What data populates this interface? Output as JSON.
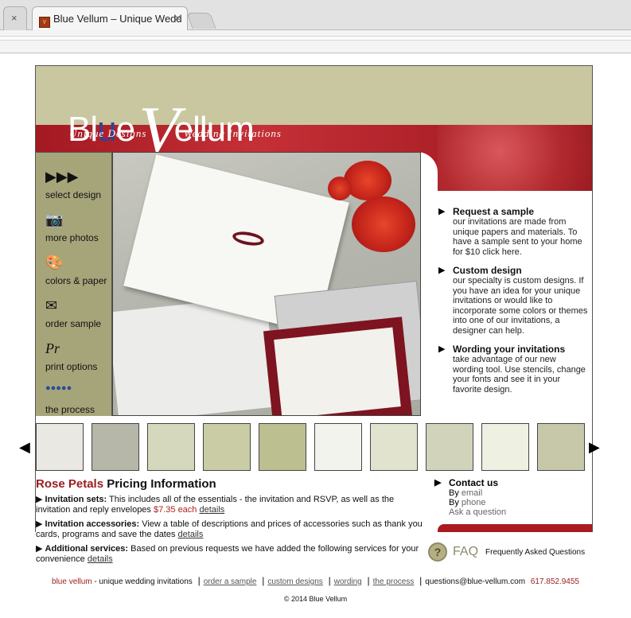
{
  "browser": {
    "active_tab_title": "Blue Vellum – Unique Wedd",
    "close_glyph": "×"
  },
  "site": {
    "logo_blue": "Blue",
    "logo_v": "V",
    "logo_rest": "ellum",
    "tagline_left": "Unique Designs",
    "tagline_right": "Wedding Invitations",
    "nav": [
      {
        "label": "select design",
        "icon": "arrows-icon"
      },
      {
        "label": "more photos",
        "icon": "camera-icon"
      },
      {
        "label": "colors & paper",
        "icon": "palette-icon"
      },
      {
        "label": "order sample",
        "icon": "envelope-icon"
      },
      {
        "label": "print options",
        "icon": "print-icon"
      },
      {
        "label": "the process",
        "icon": "process-icon"
      }
    ],
    "info": [
      {
        "title": "Request a sample",
        "text": "our invitations are made from unique papers and materials. To have a sample sent to your home for $10 click here."
      },
      {
        "title": "Custom design",
        "text": "our specialty is custom designs. If you have an idea for your unique invitations or would like to incorporate some colors or themes into one of our invitations, a designer can help."
      },
      {
        "title": "Wording your invitations",
        "text": "take advantage of our new wording tool. Use stencils, change your fonts and see it in your favorite design."
      }
    ],
    "pricing": {
      "title_red": "Rose Petals",
      "title_rest": " Pricing Information",
      "rows": [
        {
          "head": "Invitation sets:",
          "text": " This includes all of the essentials - the invitation and RSVP, as well as the invitation and reply envelopes ",
          "price": "$7.35 each",
          "link": "details"
        },
        {
          "head": "Invitation accessories:",
          "text": " View a table of descriptions and prices of accessories such as thank you cards, programs and save the dates ",
          "price": "",
          "link": "details"
        },
        {
          "head": "Additional services:",
          "text": " Based on previous requests we have added the following services for your convenience ",
          "price": "",
          "link": "details"
        }
      ]
    },
    "contact": {
      "title": "Contact us",
      "by1": "By ",
      "email": "email",
      "by2": "By ",
      "phone": "phone",
      "ask": "Ask a question"
    },
    "faq": {
      "q": "?",
      "big": "FAQ",
      "small": "Frequently Asked Questions"
    },
    "footer": {
      "brand": "blue vellum",
      "brand_rest": " - unique wedding invitations",
      "links": [
        "order a sample",
        "custom designs",
        "wording",
        "the process"
      ],
      "email": "questions@blue-vellum.com",
      "phone": "617.852.9455",
      "copyright": "© 2014 Blue Vellum"
    },
    "arrow": "▶",
    "left_arrow": "◀"
  },
  "colors": {
    "olive": "#a6a57a",
    "header": "#c8c7a0",
    "red": "#a31922"
  }
}
